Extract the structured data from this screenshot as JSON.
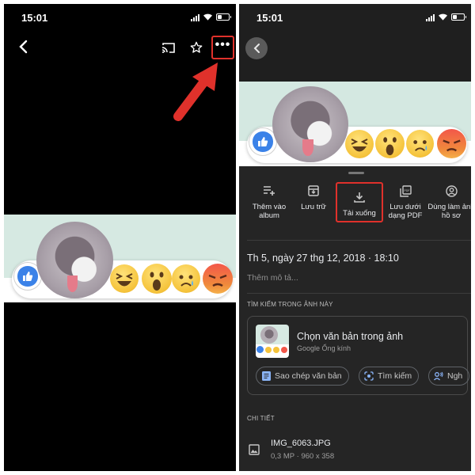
{
  "status_bar": {
    "time": "15:01"
  },
  "left_panel": {
    "toolbar": {
      "more_glyph": "•••"
    },
    "icons": [
      "back-chevron-icon",
      "cast-icon",
      "star-icon",
      "more-icon"
    ]
  },
  "right_panel": {
    "actions": [
      {
        "label": "Thêm vào album",
        "icon": "add-to-playlist-icon"
      },
      {
        "label": "Lưu trữ",
        "icon": "archive-icon"
      },
      {
        "label": "Tải xuống",
        "icon": "download-icon",
        "highlighted": true
      },
      {
        "label": "Lưu dưới dạng PDF",
        "icon": "pdf-icon"
      },
      {
        "label": "Dùng làm ảnh hồ sơ",
        "icon": "profile-icon"
      }
    ],
    "date_line": "Th 5, ngày 27 thg 12, 2018  ·  18:10",
    "description_placeholder": "Thêm mô tả...",
    "search_section_title": "TÌM KIẾM TRONG ẢNH NÀY",
    "lens_card": {
      "title": "Chọn văn bản trong ảnh",
      "subtitle": "Google Ống kính",
      "chips": [
        {
          "label": "Sao chép văn bản",
          "icon": "copy-text-icon"
        },
        {
          "label": "Tìm kiếm",
          "icon": "lens-search-icon"
        },
        {
          "label": "Ngh",
          "icon": "listen-icon"
        }
      ]
    },
    "details_section_title": "CHI TIẾT",
    "file": {
      "name": "IMG_6063.JPG",
      "meta": "0,3 MP  ·  960 x 358"
    }
  },
  "colors": {
    "highlight_red": "#e0312b",
    "sheet_bg": "#252525",
    "like_blue": "#3b82e8",
    "emoji_yellow": "#f5c33b",
    "banner_mint": "#d6e9e2"
  }
}
